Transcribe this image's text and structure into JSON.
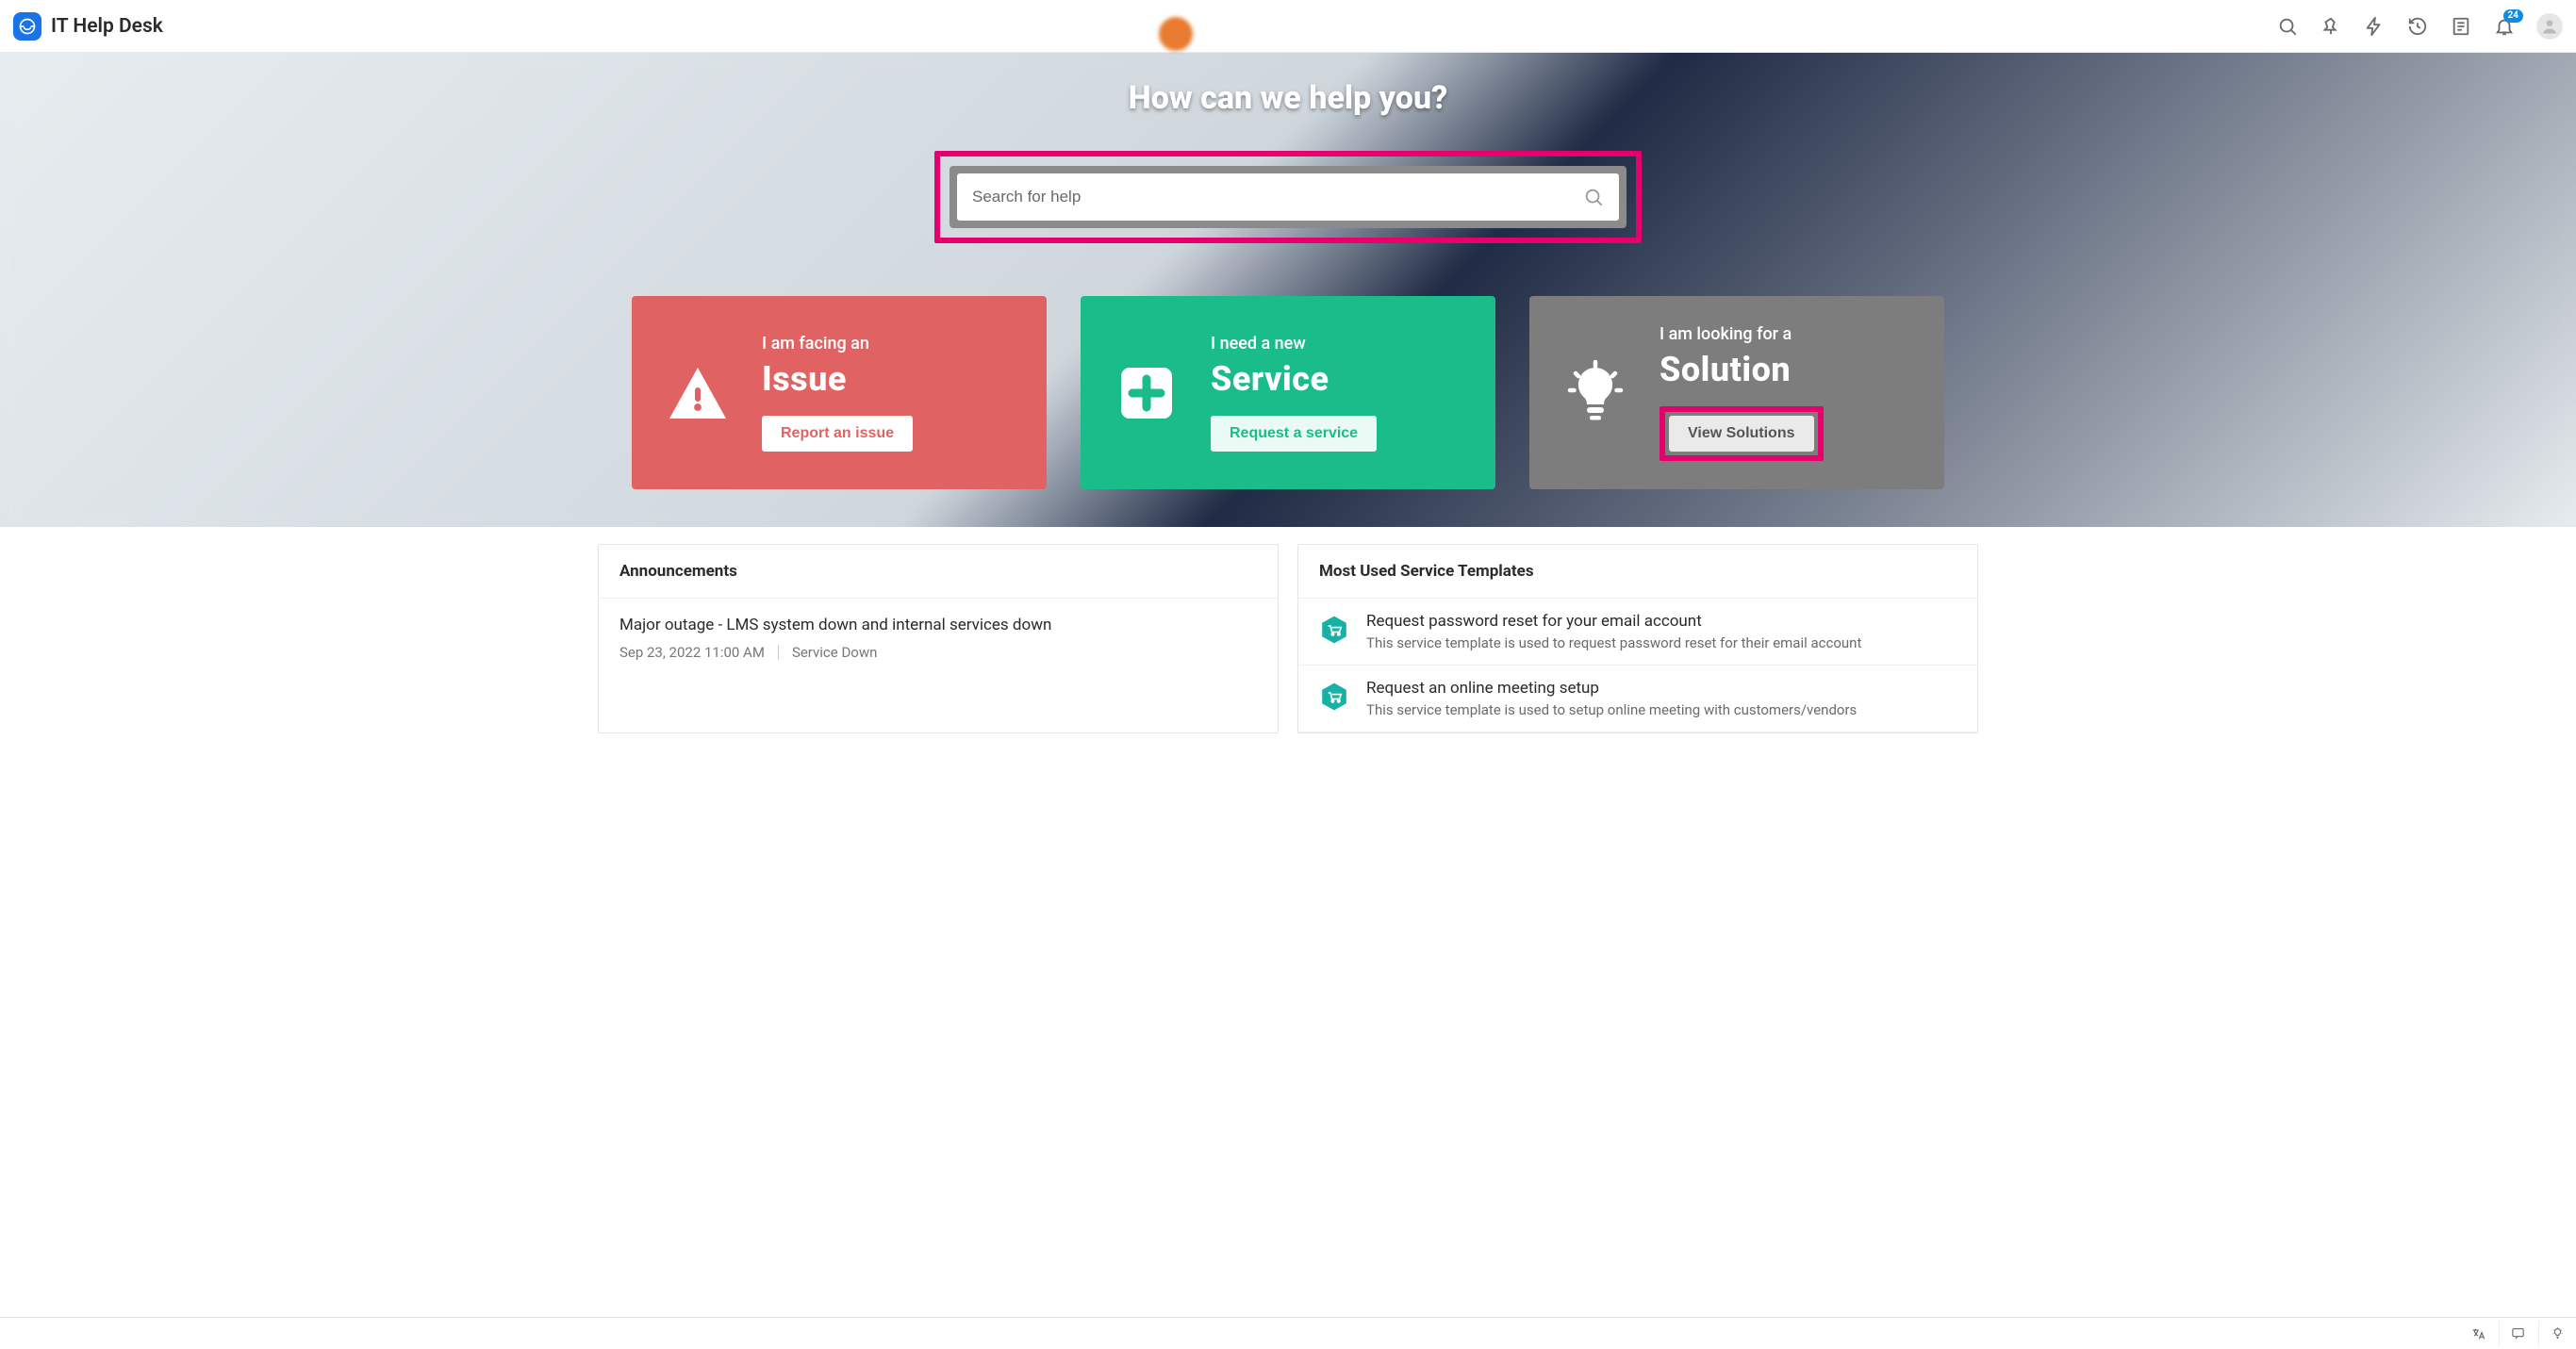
{
  "header": {
    "title": "IT Help Desk",
    "notification_count": "24"
  },
  "hero": {
    "title": "How can we help you?",
    "search_placeholder": "Search for help"
  },
  "cards": {
    "issue": {
      "lead": "I am facing an",
      "big": "Issue",
      "button": "Report an issue"
    },
    "service": {
      "lead": "I need a new",
      "big": "Service",
      "button": "Request a service"
    },
    "solution": {
      "lead": "I am looking for a",
      "big": "Solution",
      "button": "View Solutions"
    }
  },
  "announcements": {
    "heading": "Announcements",
    "items": [
      {
        "title": "Major outage - LMS system down and internal services down",
        "date": "Sep 23, 2022 11:00 AM",
        "status": "Service Down"
      }
    ]
  },
  "templates": {
    "heading": "Most Used Service Templates",
    "items": [
      {
        "title": "Request password reset for your email account",
        "desc": "This service template is used to request password reset for their email account"
      },
      {
        "title": "Request an online meeting setup",
        "desc": "This service template is used to setup online meeting with customers/vendors"
      }
    ]
  }
}
